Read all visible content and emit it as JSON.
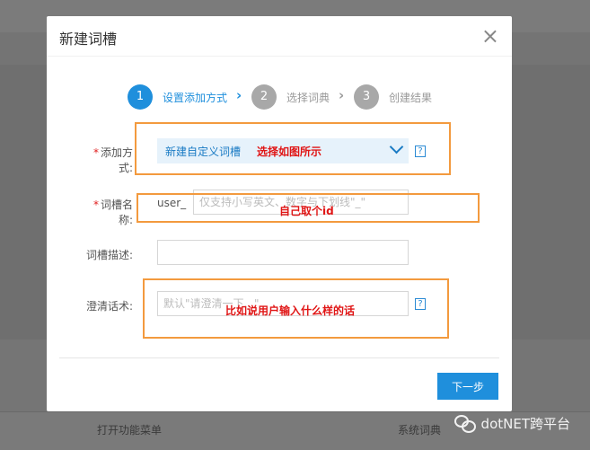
{
  "background": {
    "footer_left": "打开功能菜单",
    "footer_right": "系统词典",
    "watermark": "dotNET跨平台"
  },
  "dialog": {
    "title": "新建词槽",
    "close_glyph": "×"
  },
  "steps": [
    {
      "number": "1",
      "label": "设置添加方式",
      "state": "active"
    },
    {
      "number": "2",
      "label": "选择词典",
      "state": "inactive"
    },
    {
      "number": "3",
      "label": "创建结果",
      "state": "inactive"
    }
  ],
  "step_arrow_glyph": "›",
  "form": {
    "add_method": {
      "label": "添加方式:",
      "required": "*",
      "selected": "新建自定义词槽"
    },
    "slot_name": {
      "label": "词槽名称:",
      "required": "*",
      "prefix": "user_",
      "placeholder": "仅支持小写英文、数字与下划线\"_\""
    },
    "slot_desc": {
      "label": "词槽描述:",
      "value": ""
    },
    "clarify": {
      "label": "澄清话术:",
      "placeholder": "默认\"请澄清一下...\""
    },
    "help_glyph": "?"
  },
  "annotations": {
    "add_method": "选择如图所示",
    "slot_name": "自己取个id",
    "clarify": "比如说用户输入什么样的话"
  },
  "buttons": {
    "next": "下一步"
  },
  "colors": {
    "accent": "#1f8fdc",
    "step_active": "#1f8fdc",
    "step_inactive": "#a8a8a8",
    "annotation_border": "#f39a3e",
    "annotation_text": "#e01515"
  }
}
